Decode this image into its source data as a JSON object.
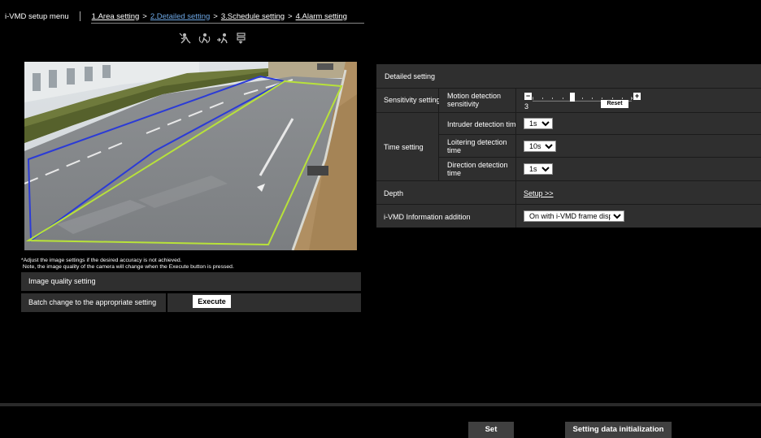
{
  "menu": {
    "title": "i-VMD setup menu",
    "steps": [
      {
        "label": "1.Area setting",
        "active": false
      },
      {
        "label": "2.Detailed setting",
        "active": true
      },
      {
        "label": "3.Schedule setting",
        "active": false
      },
      {
        "label": "4.Alarm setting",
        "active": false
      }
    ],
    "arrow": ">"
  },
  "tools": [
    "intruder-detection-icon",
    "loitering-detection-icon",
    "direction-detection-icon",
    "area-list-icon"
  ],
  "note": "*Adjust the image settings if the desired accuracy is not achieved.\n Note, the image quality of the camera will change when the Execute button is pressed.",
  "image_quality": {
    "label": "Image quality setting",
    "batch_label": "Batch change to the appropriate setting",
    "execute_label": "Execute"
  },
  "detailed": {
    "header": "Detailed setting",
    "sensitivity_label": "Sensitivity setting",
    "motion_label": "Motion detection sensitivity",
    "sensitivity_value": "3",
    "sensitivity_level": 3,
    "sensitivity_max": 10,
    "reset_label": "Reset",
    "minus": "−",
    "plus": "+",
    "time_label": "Time setting",
    "intruder_label": "Intruder detection time",
    "intruder_value": "1s",
    "loitering_label": "Loitering detection time",
    "loitering_value": "10s",
    "direction_label": "Direction detection time",
    "direction_value": "1s",
    "depth_label": "Depth",
    "setup_link": "Setup >>",
    "info_label": "i-VMD Information addition",
    "info_value": "On with i-VMD frame display"
  },
  "footer": {
    "set_label": "Set",
    "init_label": "Setting data initialization"
  },
  "colors": {
    "active_step": "#6ea8e6",
    "zone_blue": "#2b3bd6",
    "zone_yellow": "#b8e23a"
  }
}
